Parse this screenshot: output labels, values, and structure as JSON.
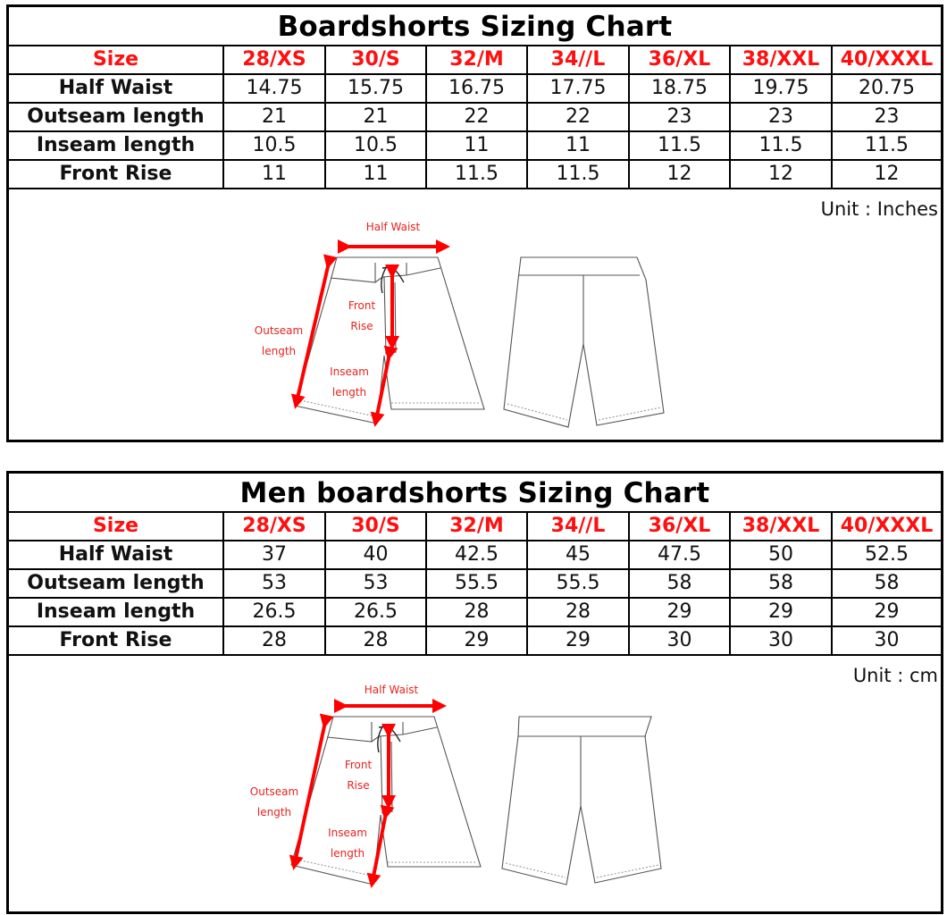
{
  "charts": [
    {
      "title": "Boardshorts Sizing Chart",
      "size_label": "Size",
      "sizes": [
        "28/XS",
        "30/S",
        "32/M",
        "34//L",
        "36/XL",
        "38/XXL",
        "40/XXXL"
      ],
      "rows": [
        {
          "label": "Half Waist",
          "values": [
            "14.75",
            "15.75",
            "16.75",
            "17.75",
            "18.75",
            "19.75",
            "20.75"
          ]
        },
        {
          "label": "Outseam length",
          "values": [
            "21",
            "21",
            "22",
            "22",
            "23",
            "23",
            "23"
          ]
        },
        {
          "label": "Inseam length",
          "values": [
            "10.5",
            "10.5",
            "11",
            "11",
            "11.5",
            "11.5",
            "11.5"
          ]
        },
        {
          "label": "Front Rise",
          "values": [
            "11",
            "11",
            "11.5",
            "11.5",
            "12",
            "12",
            "12"
          ]
        }
      ],
      "unit": "Unit : Inches",
      "diagram": {
        "half_waist": "Half Waist",
        "front_rise": [
          "Front",
          "Rise"
        ],
        "outseam": [
          "Outseam",
          "length"
        ],
        "inseam": [
          "Inseam",
          "length"
        ]
      }
    },
    {
      "title": "Men boardshorts Sizing Chart",
      "size_label": "Size",
      "sizes": [
        "28/XS",
        "30/S",
        "32/M",
        "34//L",
        "36/XL",
        "38/XXL",
        "40/XXXL"
      ],
      "rows": [
        {
          "label": "Half Waist",
          "values": [
            "37",
            "40",
            "42.5",
            "45",
            "47.5",
            "50",
            "52.5"
          ]
        },
        {
          "label": "Outseam length",
          "values": [
            "53",
            "53",
            "55.5",
            "55.5",
            "58",
            "58",
            "58"
          ]
        },
        {
          "label": "Inseam length",
          "values": [
            "26.5",
            "26.5",
            "28",
            "28",
            "29",
            "29",
            "29"
          ]
        },
        {
          "label": "Front Rise",
          "values": [
            "28",
            "28",
            "29",
            "29",
            "30",
            "30",
            "30"
          ]
        }
      ],
      "unit": "Unit : cm",
      "diagram": {
        "half_waist": "Half Waist",
        "front_rise": [
          "Front",
          "Rise"
        ],
        "outseam": [
          "Outseam",
          "length"
        ],
        "inseam": [
          "Inseam",
          "length"
        ]
      }
    }
  ],
  "colors": {
    "size_text": "#ff0f0f",
    "annotation": "#e8231f",
    "border": "#000000"
  }
}
